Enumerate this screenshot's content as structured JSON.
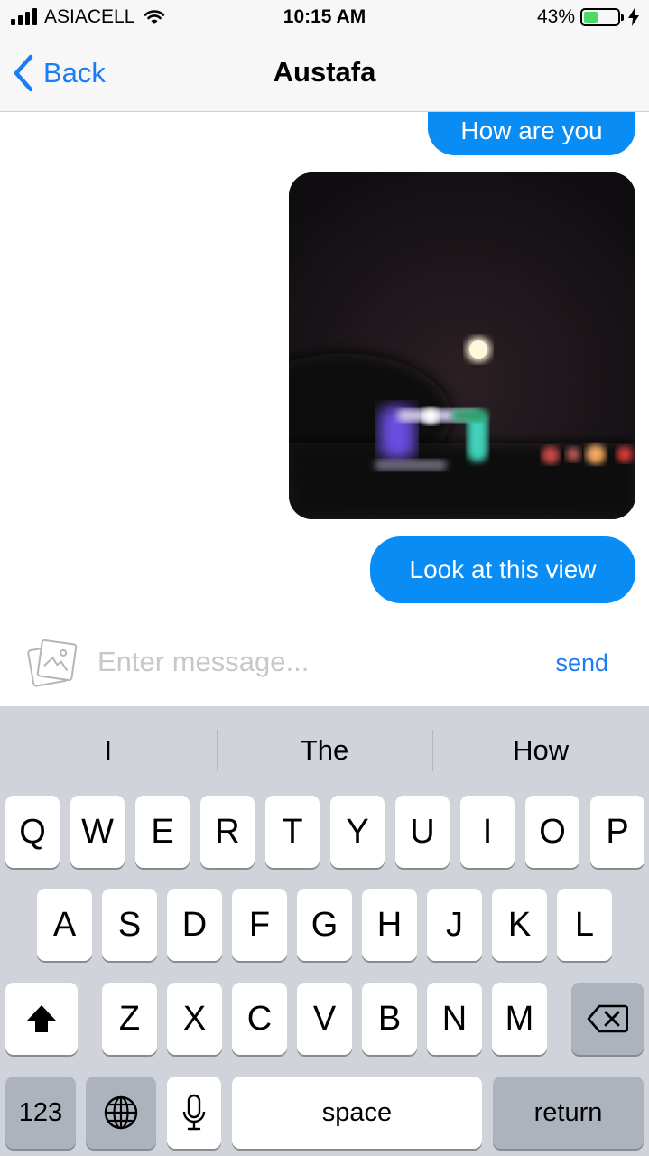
{
  "status_bar": {
    "carrier": "ASIACELL",
    "time": "10:15 AM",
    "battery_percent": "43%",
    "battery_level": 0.43,
    "icons": [
      "signal-icon",
      "wifi-icon",
      "battery-icon",
      "charging-bolt-icon"
    ]
  },
  "nav": {
    "back_label": "Back",
    "title": "Austafa",
    "accent_color": "#1a7cf6"
  },
  "messages": [
    {
      "type": "text",
      "text": "How are you",
      "sender": "me",
      "color": "#0a8cf5"
    },
    {
      "type": "image",
      "description_icon": "night-photo-image",
      "sender": "me"
    },
    {
      "type": "text",
      "text": "Look at this view",
      "sender": "me",
      "color": "#0a8cf5"
    }
  ],
  "composer": {
    "placeholder": "Enter message...",
    "value": "",
    "send_label": "send",
    "attach_icon": "photo-attach-icon"
  },
  "keyboard": {
    "suggestions": [
      "I",
      "The",
      "How"
    ],
    "row1": [
      "Q",
      "W",
      "E",
      "R",
      "T",
      "Y",
      "U",
      "I",
      "O",
      "P"
    ],
    "row2": [
      "A",
      "S",
      "D",
      "F",
      "G",
      "H",
      "J",
      "K",
      "L"
    ],
    "row3": [
      "Z",
      "X",
      "C",
      "V",
      "B",
      "N",
      "M"
    ],
    "numbers_label": "123",
    "space_label": "space",
    "return_label": "return",
    "icons": [
      "shift-icon",
      "backspace-icon",
      "globe-icon",
      "microphone-icon"
    ]
  }
}
